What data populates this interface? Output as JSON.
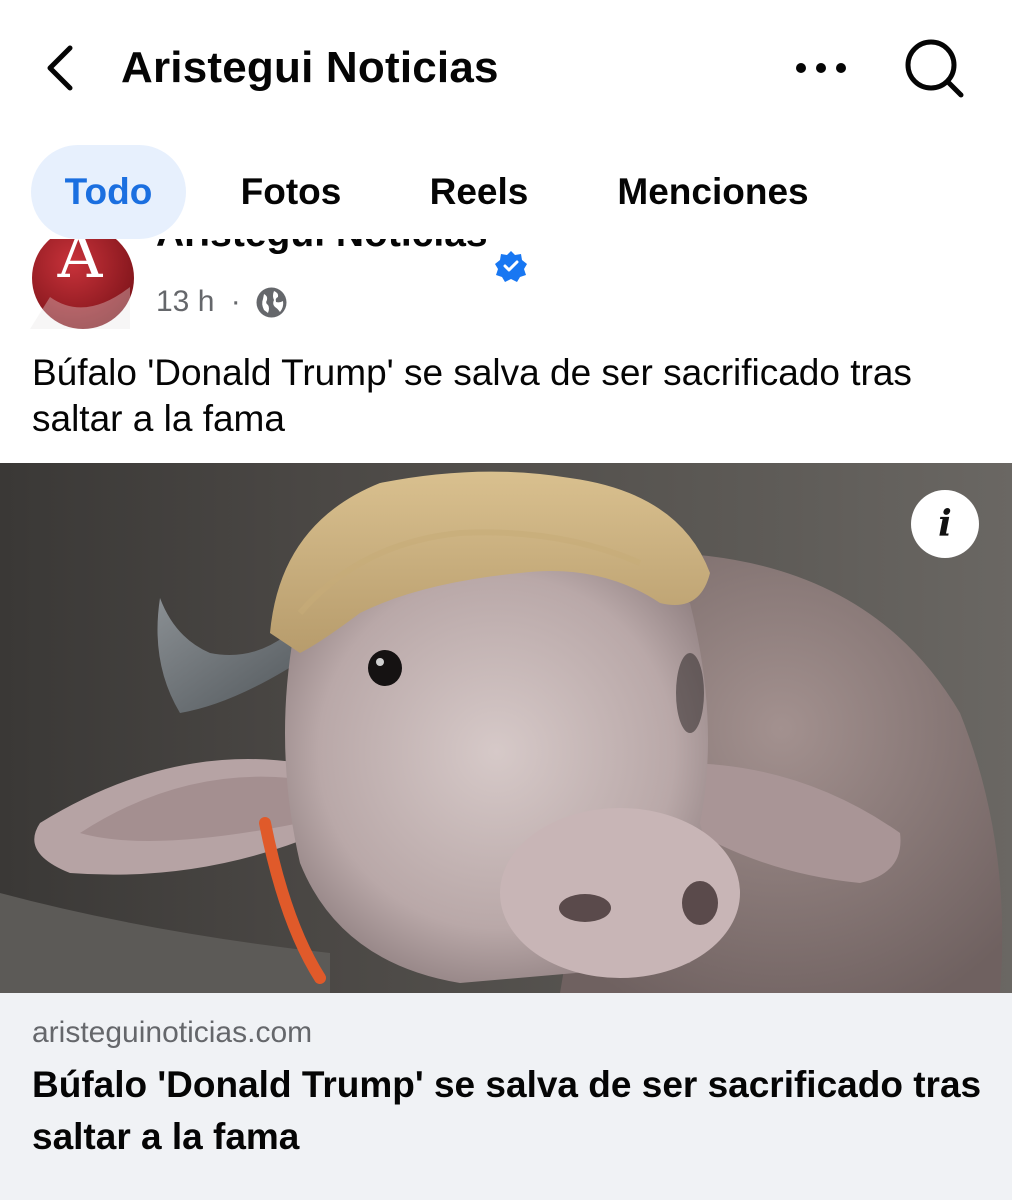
{
  "header": {
    "title": "Aristegui Noticias"
  },
  "tabs": [
    {
      "label": "Todo",
      "active": true
    },
    {
      "label": "Fotos",
      "active": false
    },
    {
      "label": "Reels",
      "active": false
    },
    {
      "label": "Menciones",
      "active": false
    }
  ],
  "post": {
    "page_name": "Aristegui Noticias",
    "avatar_letter": "A",
    "verified": true,
    "time": "13 h",
    "separator": "·",
    "audience_icon": "globe-icon",
    "text": "Búfalo 'Donald Trump' se salva de ser sacrificado tras saltar a la fama",
    "image_description_icon": "info-icon"
  },
  "link_preview": {
    "domain": "aristeguinoticias.com",
    "title": "Búfalo 'Donald Trump' se salva de ser sacrificado tras saltar a la fama"
  },
  "colors": {
    "accent": "#1b6fe0",
    "active_tab_bg": "#e7f0fd",
    "meta_gray": "#65676b",
    "card_bg": "#f0f2f5",
    "verified_blue": "#1877f2",
    "avatar_red": "#b0232a"
  }
}
